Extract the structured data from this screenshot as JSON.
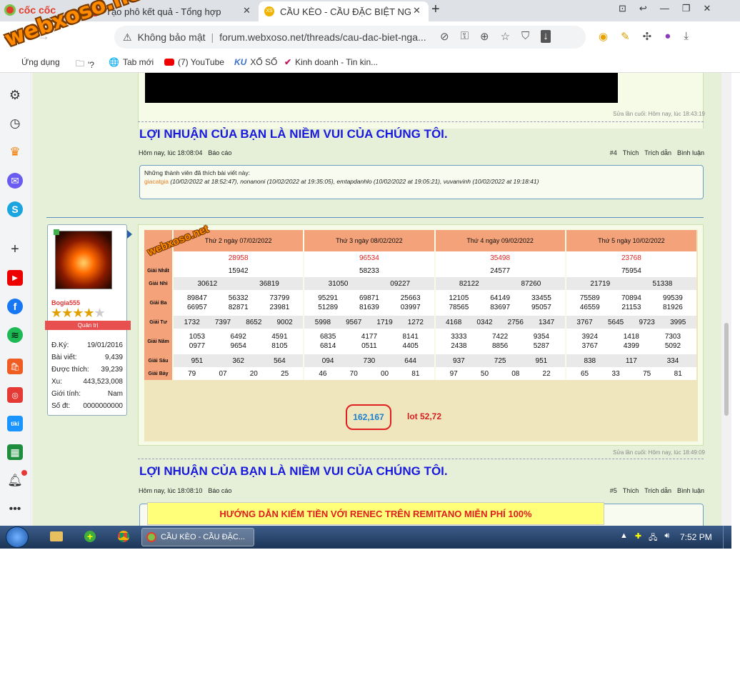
{
  "browser": {
    "tab1_title": "Tạo phô kết quả - Tổng hợp",
    "tab2_title": "CẦU KÈO - CẦU ĐẶC BIỆT NG",
    "security_label": "Không bảo mật",
    "url": "forum.webxoso.net/threads/cau-dac-biet-nga...",
    "brand": "cốc cốc",
    "watermark": "webxoso.net"
  },
  "bookmarks": {
    "apps": "Ứng dụng",
    "folder": "'?",
    "newtab": "Tab mới",
    "youtube": "(7) YouTube",
    "xoso": "XỔ SỐ",
    "kinhdoanh": "Kinh doanh - Tin kin..."
  },
  "post1": {
    "edited": "Sửa lần cuối: Hôm nay, lúc 18:43:19",
    "headline": "LỢI NHUẬN CỦA BẠN LÀ NIỀM VUI CỦA CHÚNG TÔI.",
    "time": "Hôm nay, lúc 18:08:04",
    "report": "Báo cáo",
    "num": "#4",
    "like": "Thích",
    "quote": "Trích dẫn",
    "comment": "Bình luận",
    "likes_title": "Những thành viên đã thích bài viết này:",
    "likes_u1": "giacatgia",
    "likes_rest": "(10/02/2022 at 18:52:47), nonanoni (10/02/2022 at 19:35:05), emtapdanhlo (10/02/2022 at 19:05:21), vuvanvinh (10/02/2022 at 19:18:41)"
  },
  "user": {
    "name": "Bogia555",
    "role": "Quản trị",
    "rows": [
      {
        "k": "Đ.Ký:",
        "v": "19/01/2016"
      },
      {
        "k": "Bài viết:",
        "v": "9,439"
      },
      {
        "k": "Được thích:",
        "v": "39,239"
      },
      {
        "k": "Xu:",
        "v": "443,523,008"
      },
      {
        "k": "Giới tính:",
        "v": "Nam"
      },
      {
        "k": "Số đt:",
        "v": "0000000000"
      }
    ]
  },
  "results": {
    "labels": [
      "Giải Nhất",
      "Giải Nhì",
      "Giải Ba",
      "Giải Tư",
      "Giải Năm",
      "Giải Sáu",
      "Giải Bảy"
    ],
    "days": [
      {
        "title": "Thứ 2 ngày 07/02/2022",
        "db": "28958",
        "g1": "15942",
        "g2": [
          "30612",
          "36819"
        ],
        "g3": [
          "89847",
          "56332",
          "73799",
          "66957",
          "82871",
          "23981"
        ],
        "g4": [
          "1732",
          "7397",
          "8652",
          "9002"
        ],
        "g5": [
          "1053",
          "6492",
          "4591",
          "0977",
          "9654",
          "8105"
        ],
        "g6": [
          "951",
          "362",
          "564"
        ],
        "g7": [
          "79",
          "07",
          "20",
          "25"
        ]
      },
      {
        "title": "Thứ 3 ngày 08/02/2022",
        "db": "96534",
        "g1": "58233",
        "g2": [
          "31050",
          "09227"
        ],
        "g3": [
          "95291",
          "69871",
          "25663",
          "51289",
          "81639",
          "03997"
        ],
        "g4": [
          "5998",
          "9567",
          "1719",
          "1272"
        ],
        "g5": [
          "6835",
          "4177",
          "8141",
          "6814",
          "0511",
          "4405"
        ],
        "g6": [
          "094",
          "730",
          "644"
        ],
        "g7": [
          "46",
          "70",
          "00",
          "81"
        ]
      },
      {
        "title": "Thứ 4 ngày 09/02/2022",
        "db": "35498",
        "g1": "24577",
        "g2": [
          "82122",
          "87260"
        ],
        "g3": [
          "12105",
          "64149",
          "33455",
          "78565",
          "83697",
          "95057"
        ],
        "g4": [
          "4168",
          "0342",
          "2756",
          "1347"
        ],
        "g5": [
          "3333",
          "7422",
          "9354",
          "2438",
          "8856",
          "5287"
        ],
        "g6": [
          "937",
          "725",
          "951"
        ],
        "g7": [
          "97",
          "50",
          "08",
          "22"
        ]
      },
      {
        "title": "Thứ 5 ngày 10/02/2022",
        "db": "23768",
        "g1": "75954",
        "g2": [
          "21719",
          "51338"
        ],
        "g3": [
          "75589",
          "70894",
          "99539",
          "46559",
          "21153",
          "81926"
        ],
        "g4": [
          "3767",
          "5645",
          "9723",
          "3995"
        ],
        "g5": [
          "3924",
          "1418",
          "7303",
          "3767",
          "4399",
          "5092"
        ],
        "g6": [
          "838",
          "117",
          "334"
        ],
        "g7": [
          "65",
          "33",
          "75",
          "81"
        ]
      }
    ],
    "prediction": "162,167",
    "lot": "lot 52,72"
  },
  "post2": {
    "edited": "Sửa lần cuối: Hôm nay, lúc 18:49:09",
    "headline": "LỢI NHUẬN CỦA BẠN LÀ NIỀM VUI CỦA CHÚNG TÔI.",
    "time": "Hôm nay, lúc 18:08:10",
    "report": "Báo cáo",
    "num": "#5",
    "like": "Thích",
    "quote": "Trích dẫn",
    "comment": "Bình luận",
    "banner": "HƯỚNG DẪN KIẾM TIỀN VỚI RENEC TRÊN REMITANO MIỄN PHÍ 100%"
  },
  "taskbar": {
    "window": "CẦU KÈO - CẦU ĐẶC...",
    "time": "7:52 PM"
  }
}
